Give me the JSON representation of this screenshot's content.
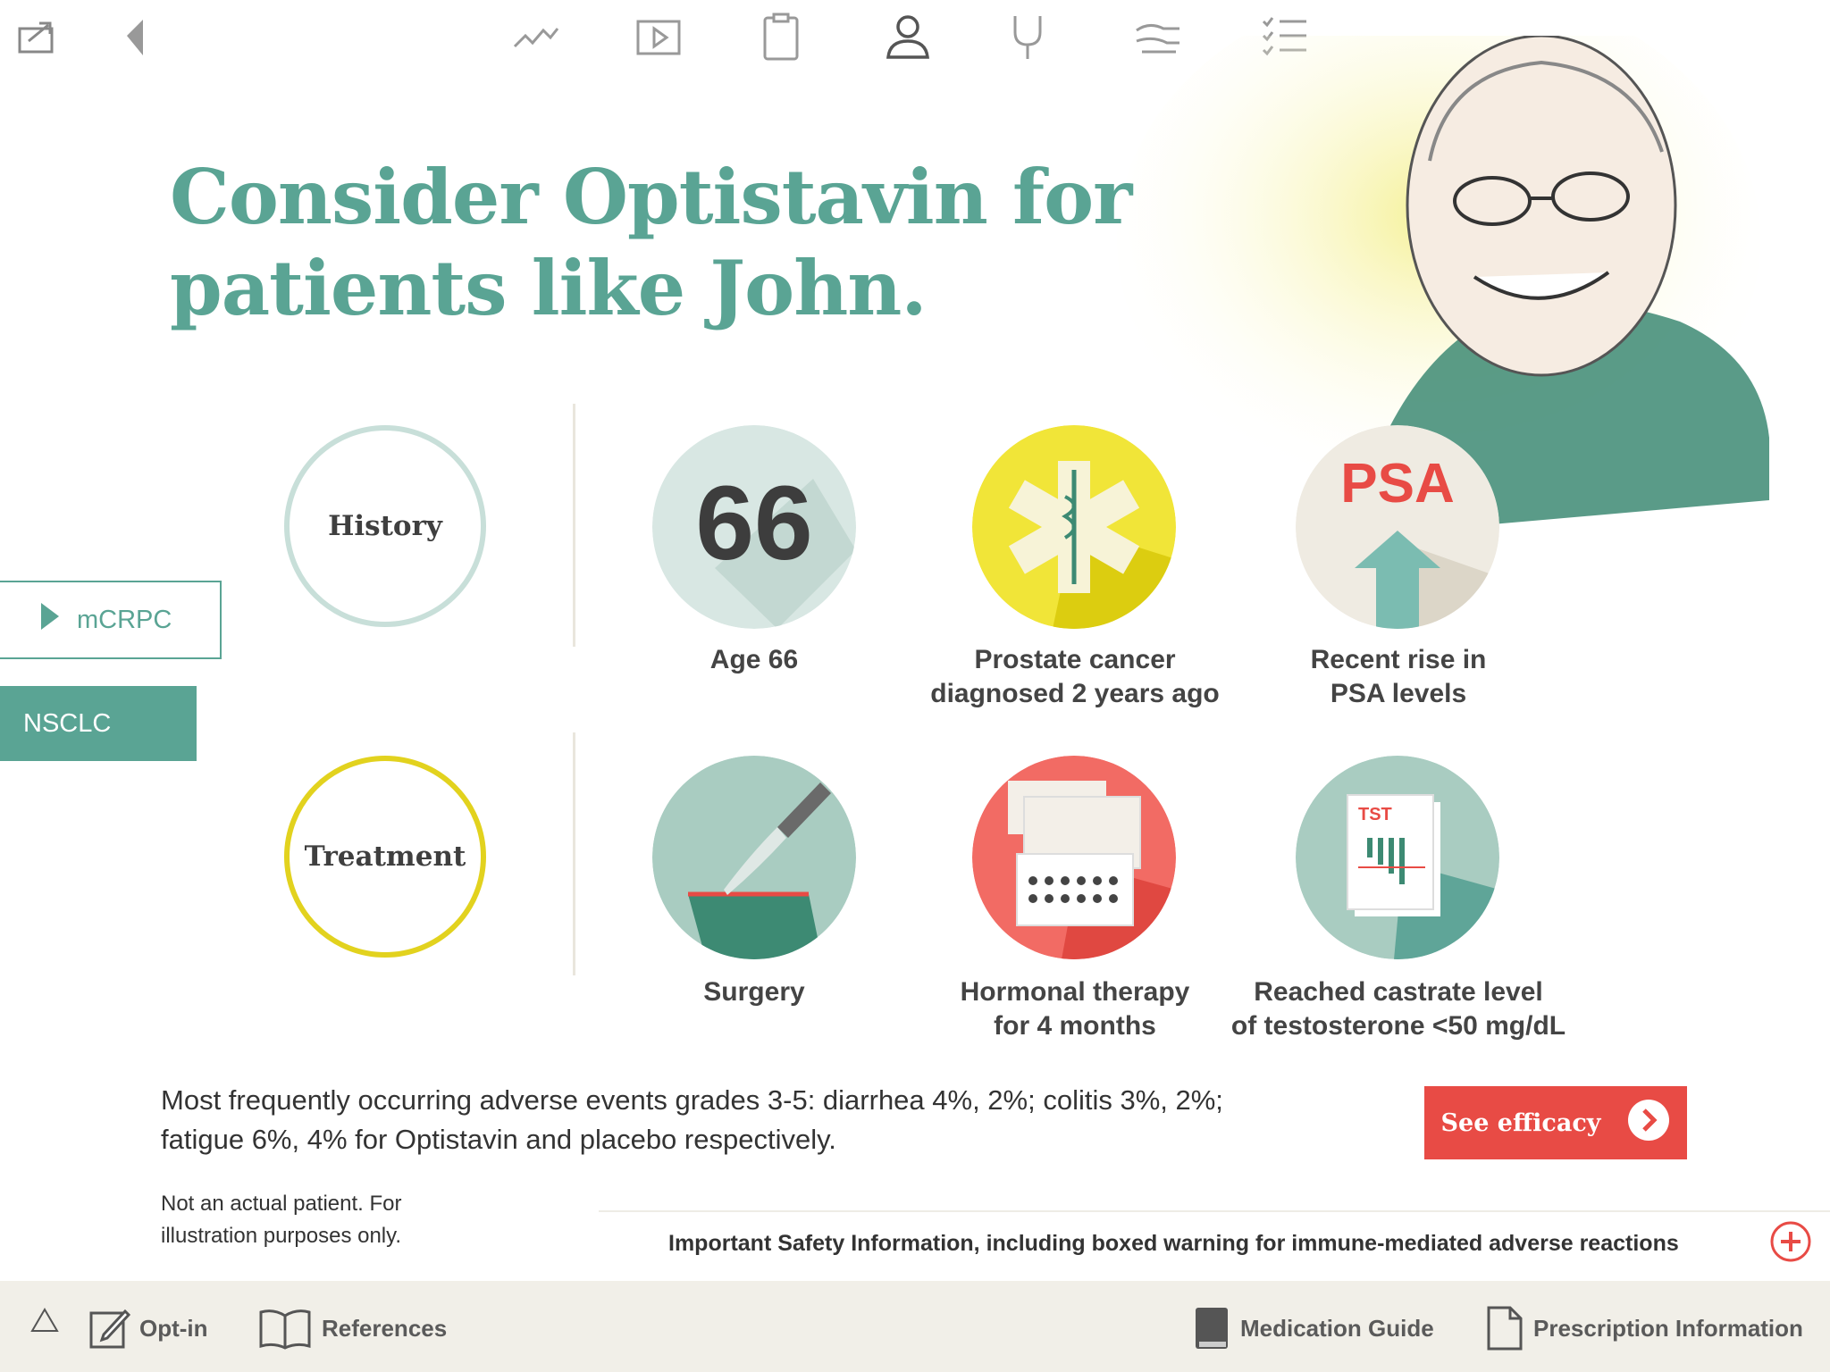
{
  "nav": {
    "icons": [
      "share-icon",
      "back-icon",
      "trend-icon",
      "video-icon",
      "clipboard-icon",
      "patient-icon",
      "stethoscope-icon",
      "hands-icon",
      "checklist-icon"
    ]
  },
  "headline": {
    "line1": "Consider Optistavin for",
    "line2": "patients like John."
  },
  "sidebar": {
    "tab1": "mCRPC",
    "tab2": "NSCLC"
  },
  "history": {
    "title": "History",
    "items": [
      {
        "value": "66",
        "label1": "Age 66",
        "label2": ""
      },
      {
        "label1": "Prostate cancer",
        "label2": "diagnosed 2 years ago"
      },
      {
        "value": "PSA",
        "label1": "Recent rise in",
        "label2": "PSA levels"
      }
    ]
  },
  "treatment": {
    "title": "Treatment",
    "items": [
      {
        "label1": "Surgery",
        "label2": ""
      },
      {
        "label1": "Hormonal therapy",
        "label2": "for 4 months"
      },
      {
        "value": "TST",
        "label1": "Reached castrate level",
        "label2": "of testosterone <50 mg/dL"
      }
    ]
  },
  "adverse": {
    "line1": "Most frequently occurring adverse events grades 3-5: diarrhea 4%, 2%; colitis 3%, 2%;",
    "line2": "fatigue 6%, 4% for Optistavin and placebo respectively."
  },
  "note": {
    "line1": "Not an actual patient. For",
    "line2": "illustration purposes only."
  },
  "cta": {
    "label": "See efficacy"
  },
  "isi": {
    "text": "Important Safety Information, including boxed warning for immune-mediated adverse reactions"
  },
  "bottom": {
    "optin": "Opt-in",
    "references": "References",
    "medguide": "Medication Guide",
    "prescribing": "Prescription Information"
  },
  "colors": {
    "accent_teal": "#5aa494",
    "cta_red": "#e84b45",
    "treatment_yellow": "#e2d21e",
    "history_ring": "#c8dfd9"
  }
}
